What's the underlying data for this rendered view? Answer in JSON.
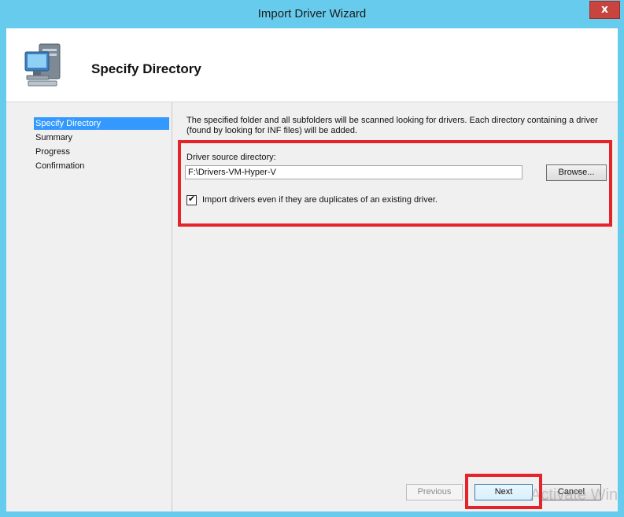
{
  "window": {
    "title": "Import Driver Wizard",
    "close_label": "x"
  },
  "header": {
    "title": "Specify Directory",
    "icon": "computer-icon"
  },
  "nav": {
    "items": [
      {
        "label": "Specify Directory",
        "selected": true
      },
      {
        "label": "Summary",
        "selected": false
      },
      {
        "label": "Progress",
        "selected": false
      },
      {
        "label": "Confirmation",
        "selected": false
      }
    ]
  },
  "content": {
    "description": "The specified folder and all subfolders will be scanned looking for drivers.  Each directory containing a driver (found by looking for INF files) will be added.",
    "dir_label": "Driver source directory:",
    "dir_value": "F:\\Drivers-VM-Hyper-V",
    "browse_label": "Browse...",
    "dup_checked": true,
    "dup_label": "Import drivers even if they are duplicates of an existing driver."
  },
  "buttons": {
    "previous": "Previous",
    "next": "Next",
    "cancel": "Cancel"
  },
  "watermark": "Activate Win",
  "colors": {
    "titlebar": "#67cbee",
    "highlight": "#e5232a",
    "selection": "#3399ff"
  }
}
